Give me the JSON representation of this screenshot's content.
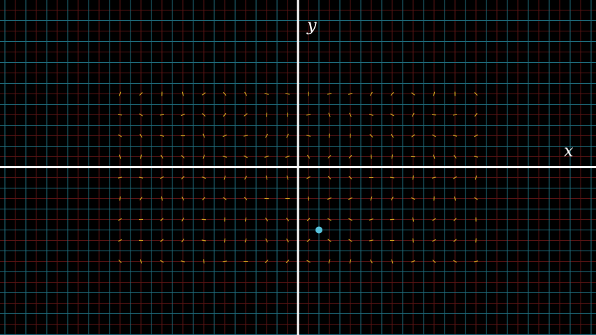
{
  "plane": {
    "x_axis_label": "x",
    "y_axis_label": "y",
    "axis_color": "#ffffff",
    "major_grid_color": "#1f6f80",
    "minor_grid_color": "#5a1414",
    "vector_color": "#e8c020",
    "point_color": "#58c4dd"
  },
  "vector_field": {
    "x_range": [
      -9,
      8
    ],
    "y_range": [
      -5,
      4
    ]
  },
  "point": {
    "x": 1,
    "y": -3
  }
}
